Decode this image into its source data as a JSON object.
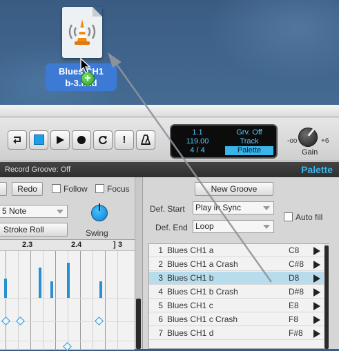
{
  "desktop": {
    "file": {
      "label_line1": "Blues CH1",
      "label_line2": "b-3.mid",
      "icon": "vlc-cone-icon"
    },
    "drag_badge": "+"
  },
  "toolbar": {
    "buttons": [
      {
        "name": "loop-button",
        "icon": "loop-arrow-icon",
        "glyph": "⮐"
      },
      {
        "name": "stop-button",
        "icon": "stop-square-icon",
        "glyph": ""
      },
      {
        "name": "play-button",
        "icon": "play-icon",
        "glyph": "▶"
      },
      {
        "name": "record-button",
        "icon": "record-icon",
        "glyph": "●"
      },
      {
        "name": "refresh-button",
        "icon": "refresh-icon",
        "glyph": "↻"
      },
      {
        "name": "alert-button",
        "icon": "exclamation-icon",
        "glyph": "!"
      },
      {
        "name": "metronome-button",
        "icon": "metronome-icon",
        "glyph": "◭"
      }
    ],
    "lcd": {
      "position": "1.1",
      "tempo": "119.00",
      "meter": "4 / 4",
      "groove_status": "Grv. Off",
      "mode_track": "Track",
      "mode_palette": "Palette"
    },
    "gain": {
      "label": "Gain",
      "low": "-oo",
      "high": "+6"
    }
  },
  "statusbar": {
    "left": "Record Groove: Off",
    "right": "Palette"
  },
  "editor": {
    "redo": "Redo",
    "follow": "Follow",
    "focus": "Focus",
    "note_select": "5 Note",
    "stroke_roll": "Stroke Roll",
    "swing": "Swing",
    "ruler": [
      "2.3",
      "2.4",
      "3"
    ]
  },
  "palette_panel": {
    "new_groove": "New Groove",
    "def_start_label": "Def. Start",
    "def_start_value": "Play in Sync",
    "def_end_label": "Def. End",
    "def_end_value": "Loop",
    "auto_fill": "Auto fill",
    "grooves": [
      {
        "num": "1",
        "name": "Blues CH1 a",
        "key": "C8"
      },
      {
        "num": "2",
        "name": "Blues CH1 a Crash",
        "key": "C#8"
      },
      {
        "num": "3",
        "name": "Blues CH1 b",
        "key": "D8"
      },
      {
        "num": "4",
        "name": "Blues CH1 b Crash",
        "key": "D#8"
      },
      {
        "num": "5",
        "name": "Blues CH1 c",
        "key": "E8"
      },
      {
        "num": "6",
        "name": "Blues CH1 c Crash",
        "key": "F8"
      },
      {
        "num": "7",
        "name": "Blues CH1 d",
        "key": "F#8"
      }
    ],
    "selected_index": 2
  },
  "colors": {
    "accent": "#3bb5ee",
    "selection": "#b7dcec",
    "desktop": "#3d6b94"
  }
}
